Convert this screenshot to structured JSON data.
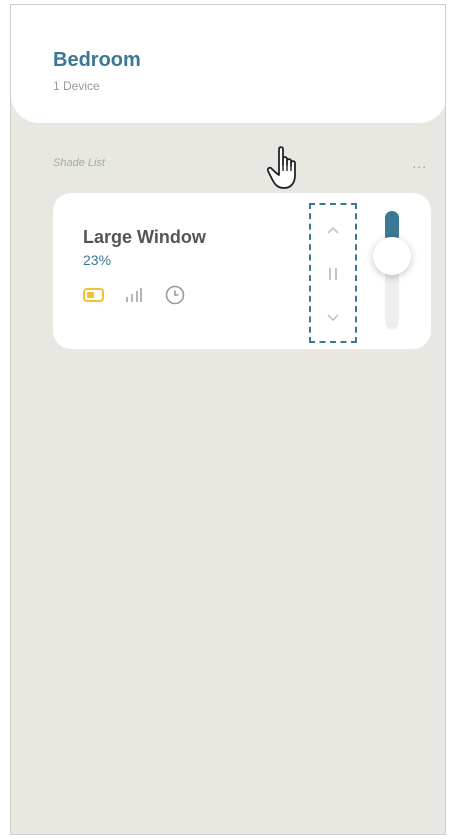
{
  "header": {
    "room_name": "Bedroom",
    "device_count": "1 Device"
  },
  "section": {
    "label": "Shade List",
    "more_icon": "..."
  },
  "shade": {
    "name": "Large Window",
    "percent_label": "23%",
    "position_fraction": 0.23,
    "status_icons": [
      "battery-icon",
      "signal-icon",
      "clock-icon"
    ]
  },
  "controls": [
    "up-chevron-icon",
    "pause-icon",
    "down-chevron-icon"
  ],
  "colors": {
    "accent": "#3a7894",
    "battery": "#f2c22e",
    "background": "#e8e7e2"
  }
}
